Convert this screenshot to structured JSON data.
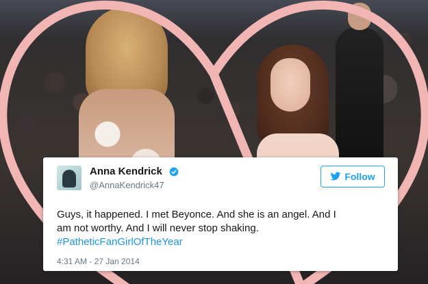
{
  "tweet": {
    "display_name": "Anna Kendrick",
    "handle": "@AnnaKendrick47",
    "follow_label": "Follow",
    "text_line1": "Guys, it happened. I met Beyonce. And she is an angel. And I",
    "text_line2": "am not worthy. And I will never stop shaking.",
    "hashtag": "#PatheticFanGirlOfTheYear",
    "timestamp": "4:31 AM - 27 Jan 2014"
  },
  "icons": {
    "verified": "verified-badge-icon",
    "follow": "twitter-bird-icon",
    "avatar": "user-avatar"
  },
  "colors": {
    "heart": "#f1b5b3",
    "twitter_blue": "#1da1f2",
    "hashtag": "#1b95e0",
    "muted_text": "#657786"
  }
}
